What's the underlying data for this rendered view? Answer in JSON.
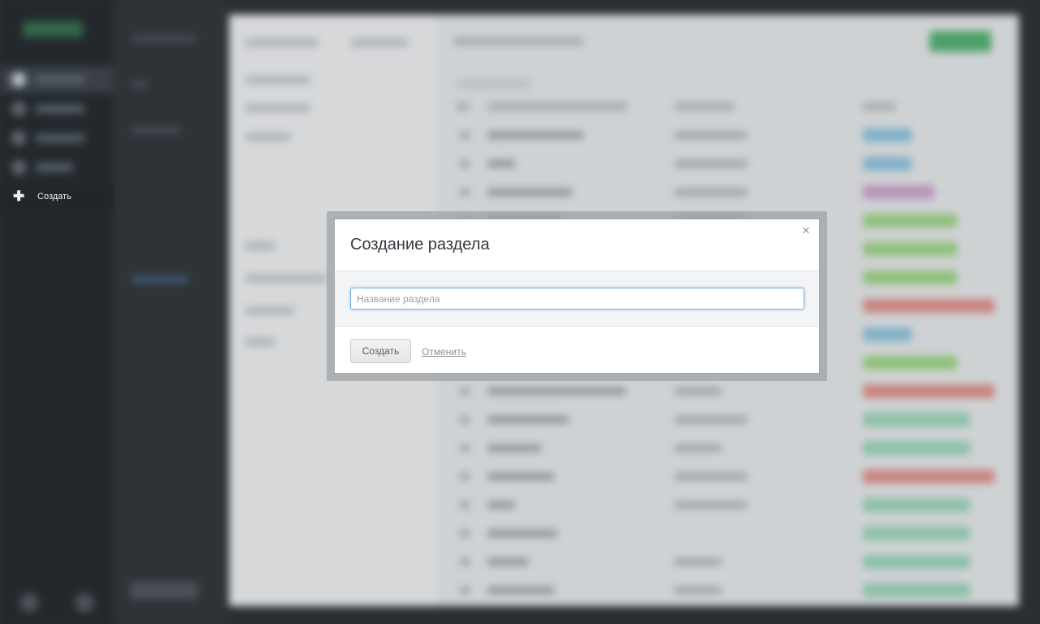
{
  "sidebar": {
    "create_label": "Создать",
    "create_icon": "plus-icon"
  },
  "modal": {
    "title": "Создание раздела",
    "close_glyph": "×",
    "input": {
      "value": "",
      "placeholder": "Название раздела"
    },
    "create_button_label": "Создать",
    "cancel_link_label": "Отменить"
  }
}
